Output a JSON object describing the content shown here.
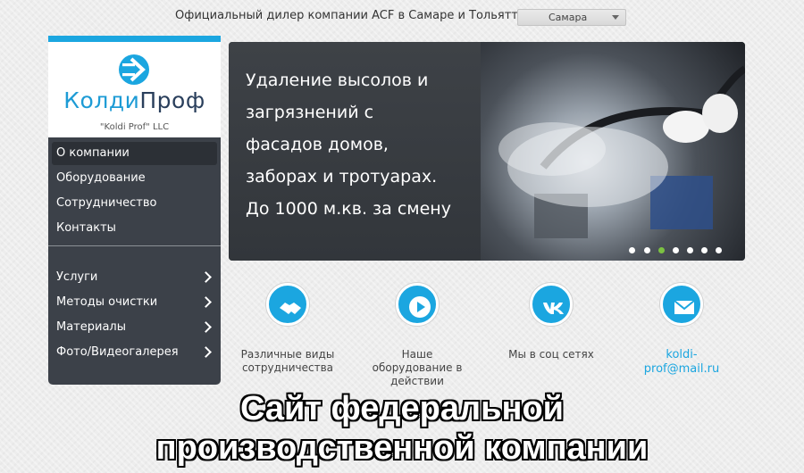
{
  "header": {
    "dealer_text": "Официальный дилер компании ACF в Самаре и Тольятти",
    "city_selected": "Самара"
  },
  "logo": {
    "name_part1": "Колди",
    "name_part2": "Проф",
    "subtitle": "\"Koldi Prof\" LLC"
  },
  "sidebar": {
    "primary_items": [
      {
        "label": "О компании"
      },
      {
        "label": "Оборудование"
      },
      {
        "label": "Сотрудничество"
      },
      {
        "label": "Контакты"
      }
    ],
    "secondary_items": [
      {
        "label": "Услуги"
      },
      {
        "label": "Методы очистки"
      },
      {
        "label": "Материалы"
      },
      {
        "label": "Фото/Видеогалерея"
      }
    ]
  },
  "hero": {
    "lines": [
      "Удаление высолов и",
      "загрязнений с",
      "фасадов домов,",
      "заборах и тротуарах.",
      "До 1000 м.кв. за смену"
    ]
  },
  "features": [
    {
      "label_lines": [
        "Различные виды",
        "сотрудничества"
      ],
      "icon": "handshake-icon"
    },
    {
      "label_lines": [
        "Наше",
        "оборудование в",
        "действии"
      ],
      "icon": "play-icon"
    },
    {
      "label_lines": [
        "Мы в соц сетях"
      ],
      "icon": "vk-icon"
    },
    {
      "label_lines": [
        "koldi-",
        "prof@mail.ru"
      ],
      "icon": "mail-icon"
    }
  ],
  "caption": {
    "line1": "Сайт федеральной",
    "line2": "производственной компании"
  },
  "colors": {
    "accent": "#1ba6e0",
    "sidebar_bg": "#3c4149",
    "slider_dot_active": "#7cc242"
  }
}
